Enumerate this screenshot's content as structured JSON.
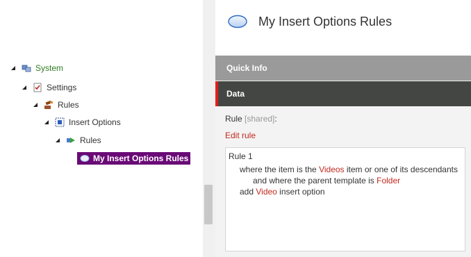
{
  "tree": {
    "items": [
      {
        "label": "System"
      },
      {
        "label": "Settings"
      },
      {
        "label": "Rules"
      },
      {
        "label": "Insert Options"
      },
      {
        "label": "Rules"
      },
      {
        "label": "My Insert Options Rules"
      }
    ]
  },
  "header": {
    "title": "My Insert Options Rules"
  },
  "sections": {
    "quick_info": "Quick Info",
    "data": "Data"
  },
  "field": {
    "label": "Rule",
    "shared": "[shared]",
    "suffix": ":"
  },
  "edit_rule": "Edit rule",
  "rule": {
    "title": "Rule 1",
    "line1": {
      "prefix": "where the item is the ",
      "item": "Videos",
      "suffix": " item or one of its descendants"
    },
    "line2": {
      "prefix": "and where the parent template is ",
      "template": "Folder"
    },
    "line3": {
      "prefix": "add ",
      "option": "Video",
      "suffix": " insert option"
    }
  },
  "colors": {
    "selected_bg": "#6a0a76",
    "accent": "#e0201c",
    "link": "#c0281d",
    "system_label": "#2e7d1e"
  }
}
